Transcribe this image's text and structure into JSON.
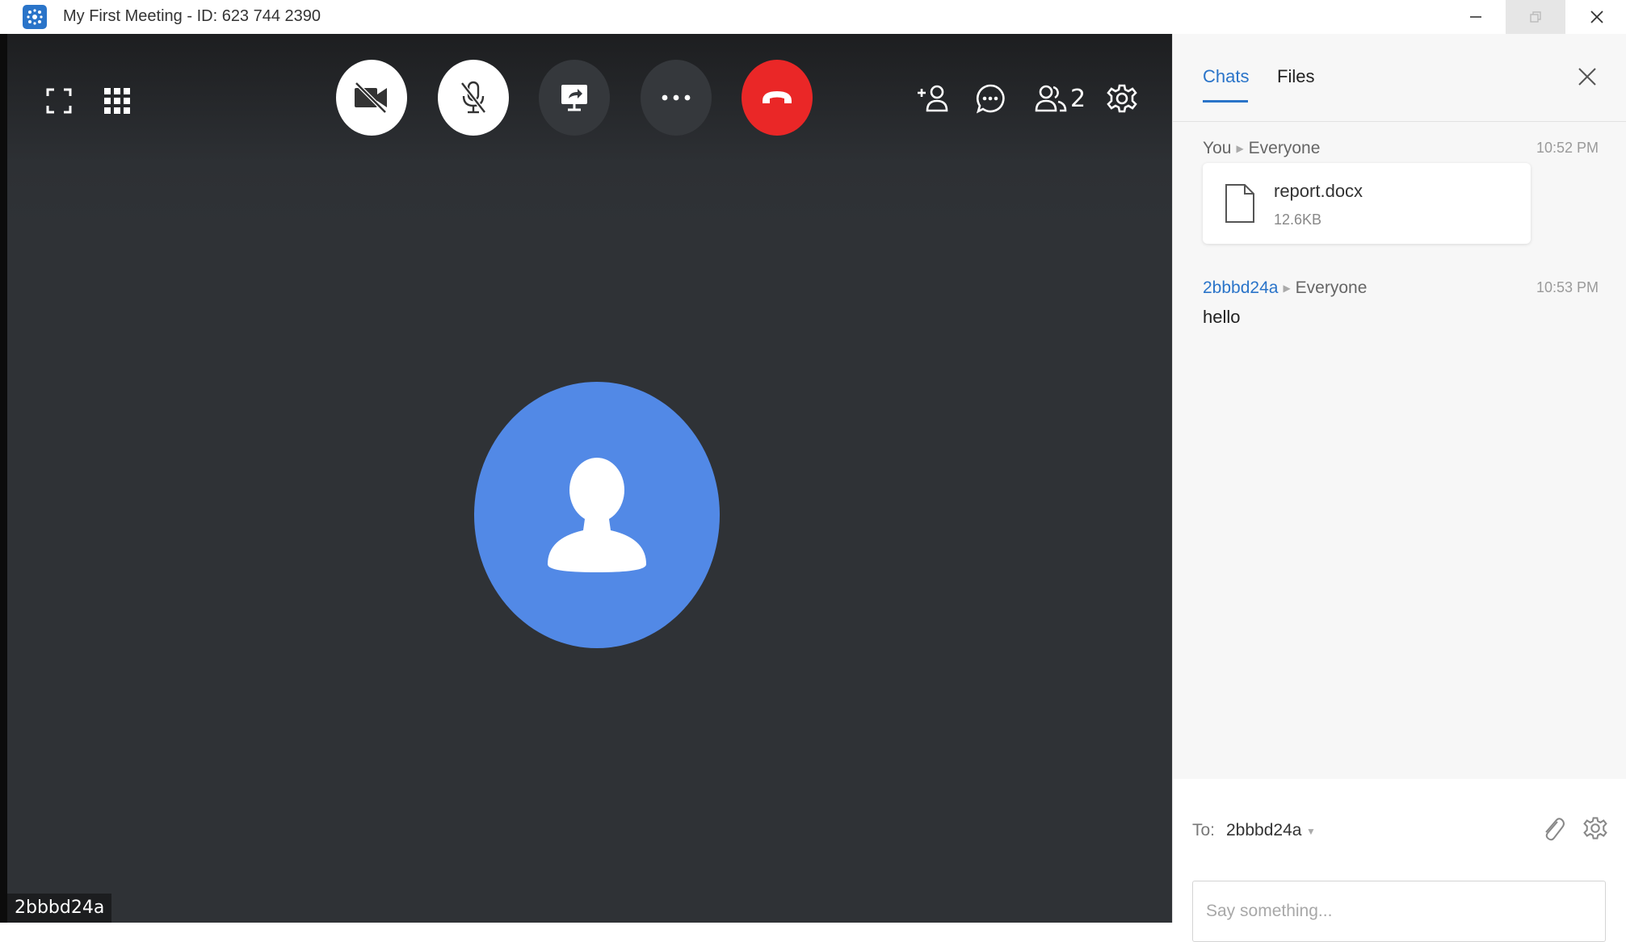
{
  "window": {
    "title": "My First Meeting - ID: 623 744 2390",
    "controls": [
      "minimize-icon",
      "restore-icon",
      "close-icon"
    ]
  },
  "toolbar": {
    "left_icons": [
      "fullscreen-icon",
      "grid-view-icon"
    ],
    "center_buttons": [
      "video-off-icon",
      "mic-off-icon",
      "share-screen-icon",
      "more-icon",
      "end-call-icon"
    ],
    "right_icons": [
      "add-participant-icon",
      "chat-icon",
      "participants-icon",
      "settings-icon"
    ],
    "participant_count": "2",
    "end_call_color": "#ea2727"
  },
  "video": {
    "participant_name": "2bbbd24a",
    "avatar_color": "#5289e6"
  },
  "chat_panel": {
    "tabs": [
      {
        "label": "Chats",
        "active": true
      },
      {
        "label": "Files",
        "active": false
      }
    ],
    "accent_color": "#2a74c9",
    "messages": [
      {
        "sender": "You",
        "recipient": "Everyone",
        "time": "10:52 PM",
        "file": {
          "name": "report.docx",
          "size": "12.6KB"
        }
      },
      {
        "sender": "2bbbd24a",
        "recipient": "Everyone",
        "time": "10:53 PM",
        "text": "hello"
      }
    ],
    "compose": {
      "to_label": "To:",
      "to_value": "2bbbd24a",
      "placeholder": "Say something..."
    }
  }
}
